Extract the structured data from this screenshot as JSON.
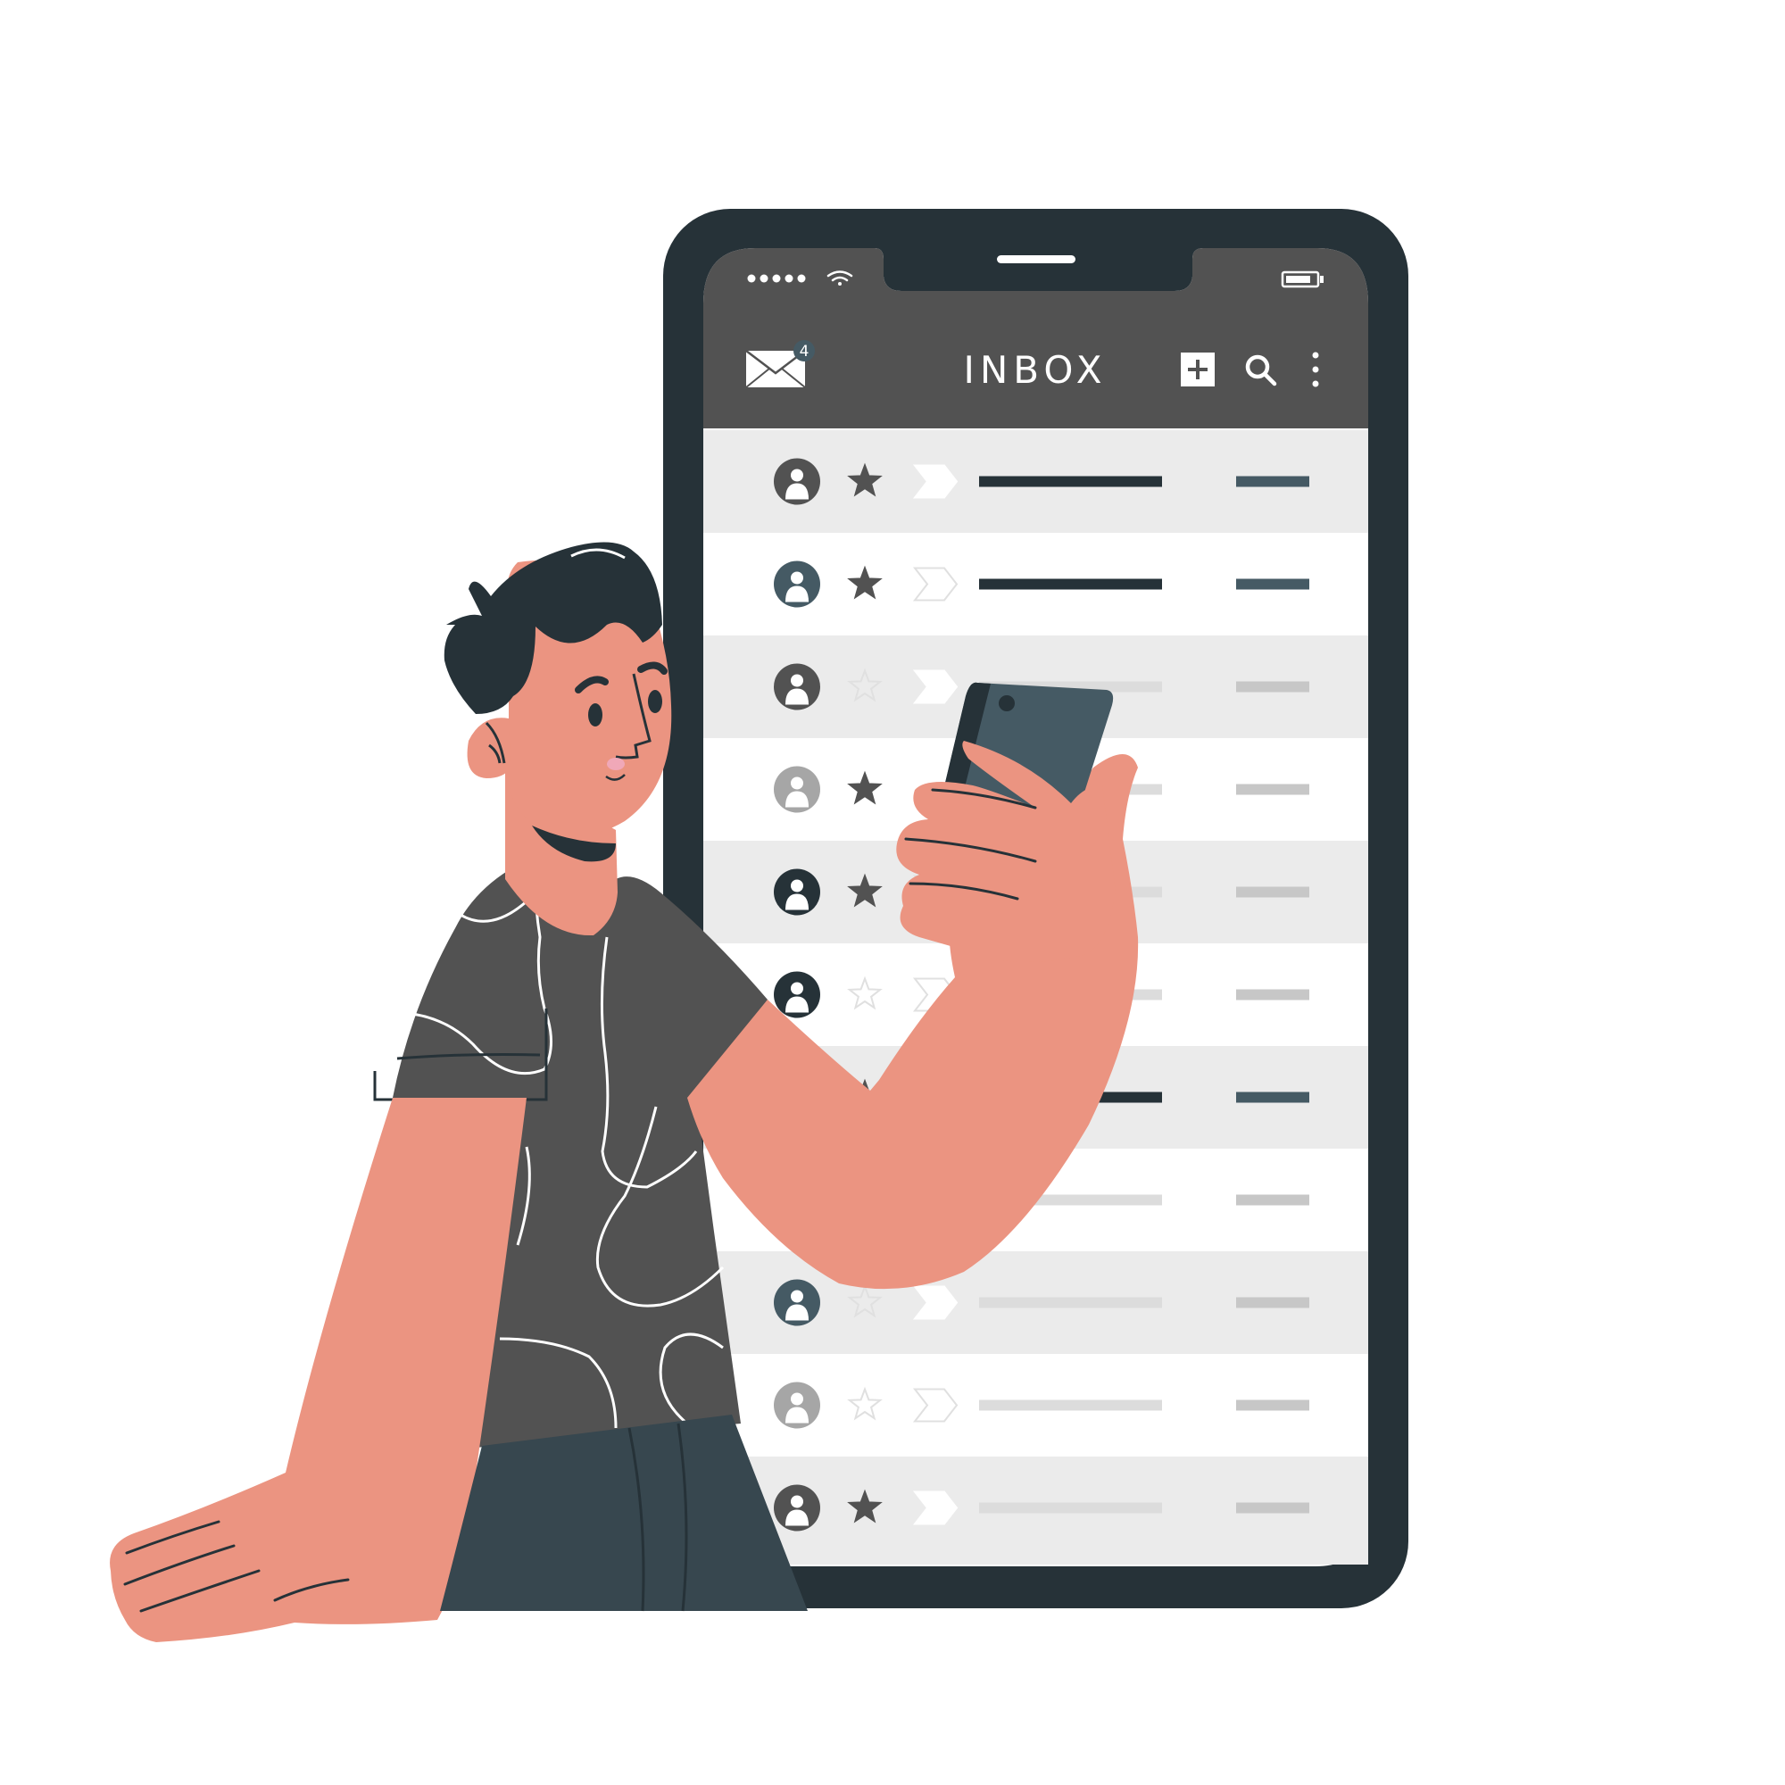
{
  "header": {
    "title": "INBOX",
    "unread_badge": "4",
    "icons": {
      "mail": "envelope-icon",
      "compose": "plus-square-icon",
      "search": "search-icon",
      "more": "more-vertical-icon"
    }
  },
  "status_bar": {
    "signal": "signal-dots-icon",
    "wifi": "wifi-icon",
    "battery": "battery-icon"
  },
  "colors": {
    "phone_frame": "#263238",
    "app_bar": "#525252",
    "row_shaded": "#ebebeb",
    "row_plain": "#ffffff",
    "skin": "#eb9481",
    "shirt": "#525252",
    "pants": "#37474f",
    "hair": "#263238",
    "accent": "#455a64"
  },
  "emails": [
    {
      "avatar": "dark",
      "starred": true,
      "important": true,
      "unread": true,
      "shaded": true
    },
    {
      "avatar": "slate",
      "starred": true,
      "important": false,
      "unread": true,
      "shaded": false
    },
    {
      "avatar": "dark",
      "starred": false,
      "important": true,
      "unread": false,
      "shaded": true
    },
    {
      "avatar": "light",
      "starred": true,
      "important": true,
      "unread": false,
      "shaded": false
    },
    {
      "avatar": "navy",
      "starred": true,
      "important": false,
      "unread": false,
      "shaded": true
    },
    {
      "avatar": "navy",
      "starred": false,
      "important": false,
      "unread": false,
      "shaded": false
    },
    {
      "avatar": "dark",
      "starred": true,
      "important": true,
      "unread": true,
      "shaded": true
    },
    {
      "avatar": "slate",
      "starred": false,
      "important": false,
      "unread": false,
      "shaded": false
    },
    {
      "avatar": "slate",
      "starred": false,
      "important": true,
      "unread": false,
      "shaded": true
    },
    {
      "avatar": "light",
      "starred": false,
      "important": false,
      "unread": false,
      "shaded": false
    },
    {
      "avatar": "dark",
      "starred": true,
      "important": true,
      "unread": false,
      "shaded": true
    }
  ]
}
